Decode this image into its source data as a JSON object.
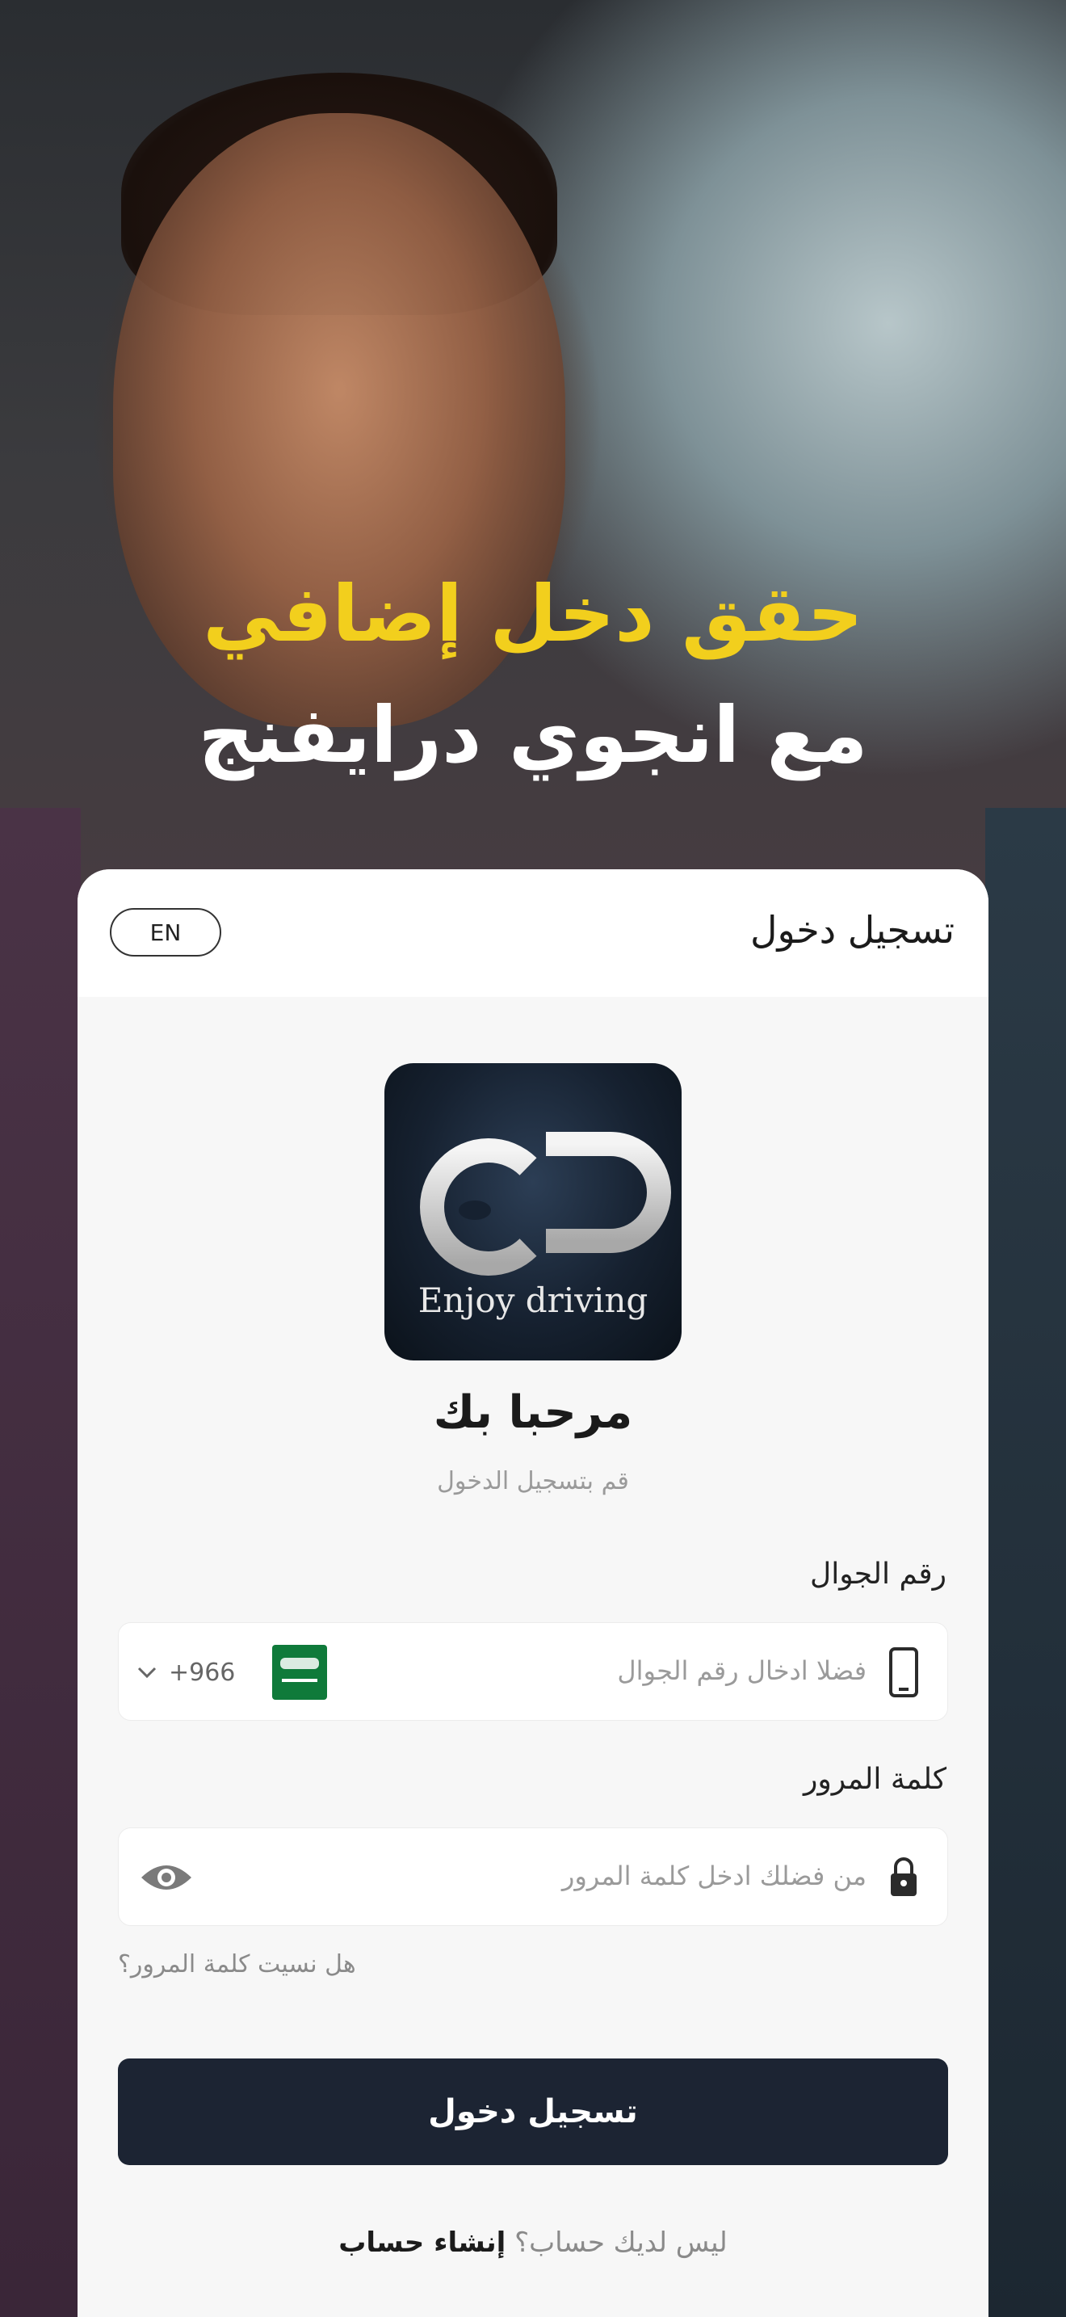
{
  "hero": {
    "headline_line1": "حقق دخل إضافي",
    "headline_line2": "مع انجوي درايفنج",
    "headline_line1_color": "#f2cf1d",
    "headline_line2_color": "#ffffff"
  },
  "header": {
    "title": "تسجيل دخول",
    "language_button": "EN"
  },
  "logo": {
    "text": "Enjoy driving"
  },
  "welcome": {
    "title": "مرحبا بك",
    "subtitle": "قم بتسجيل الدخول"
  },
  "phone": {
    "label": "رقم الجوال",
    "placeholder": "فضلا ادخال رقم الجوال",
    "country_code": "+966",
    "icon": "phone-icon",
    "flag": "saudi-flag-icon"
  },
  "password": {
    "label": "كلمة المرور",
    "placeholder": "من فضلك ادخل كلمة المرور",
    "icon": "lock-icon",
    "toggle_icon": "eye-icon"
  },
  "forgot_password": "هل نسيت كلمة المرور؟",
  "login_button": "تسجيل دخول",
  "signup": {
    "question": "ليس لديك حساب؟",
    "link": "إنشاء حساب"
  },
  "colors": {
    "accent_yellow": "#f2cf1d",
    "primary_dark": "#1c2433",
    "card_background": "#f7f7f7"
  }
}
